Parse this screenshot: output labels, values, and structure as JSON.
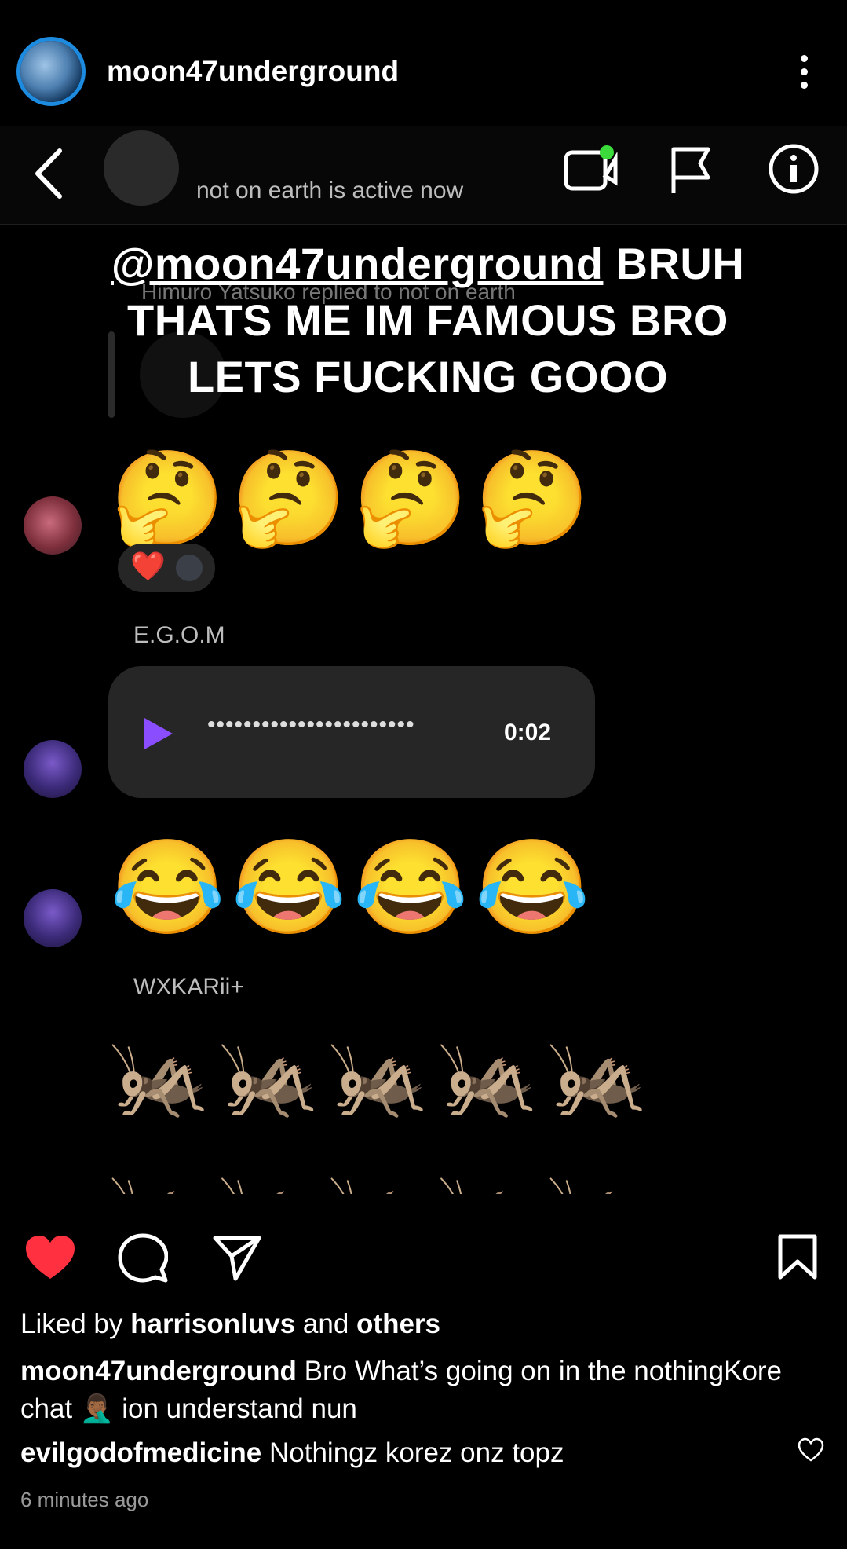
{
  "post": {
    "username": "moon47underground"
  },
  "screenshot": {
    "dm_status": "not on earth is active now",
    "overlay": {
      "mention": "@moon47underground",
      "line1_rest": " BRUH",
      "line2": "THATS ME IM FAMOUS BRO",
      "line3": "LETS FUCKING GOOO"
    },
    "reply_context": "Himuro Yatsuko replied to not on earth",
    "messages": {
      "thinking_emojis": "🤔🤔🤔🤔",
      "reactions_heart": "❤️",
      "sender1": "E.G.O.M",
      "voice_waveform": "•••••••••••••••••••••••",
      "voice_duration": "0:02",
      "laughing_emojis": "😂😂😂😂",
      "sender2": "WXKARii+",
      "cricket_emojis": "🦗🦗🦗🦗🦗"
    }
  },
  "actions": {
    "like_icon": "heart-filled-icon",
    "comment_icon": "comment-icon",
    "share_icon": "paper-plane-icon",
    "save_icon": "bookmark-icon"
  },
  "likes": {
    "prefix": "Liked by ",
    "user": "harrisonluvs",
    "middle": " and ",
    "others": "others"
  },
  "caption": {
    "user": "moon47underground",
    "text_part1": " Bro What’s going on in the nothingKore chat ",
    "emoji": "🤦🏾‍♂️",
    "text_part2": " ion understand nun"
  },
  "comment": {
    "user": "evilgodofmedicine",
    "text": " Nothingz korez onz topz"
  },
  "timestamp": "6 minutes ago",
  "colors": {
    "background": "#000000",
    "like_red": "#ff3040",
    "play_purple": "#8a4dff",
    "online_green": "#3adb3a"
  }
}
